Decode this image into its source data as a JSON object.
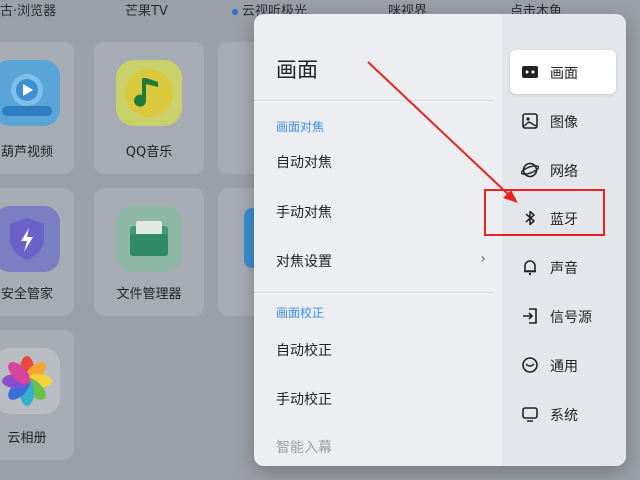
{
  "launcher": {
    "top_labels": [
      "古·浏览器",
      "芒果TV",
      "云视听极光",
      "咪视界",
      "点击木鱼"
    ],
    "tiles": [
      {
        "label": "葫芦视频"
      },
      {
        "label": "QQ音乐"
      },
      {
        "label": "安全管家"
      },
      {
        "label": "文件管理器"
      },
      {
        "label": "云相册"
      }
    ]
  },
  "panel": {
    "title": "画面",
    "sections": [
      {
        "header": "画面对焦",
        "options": [
          "自动对焦",
          "手动对焦",
          "对焦设置"
        ]
      },
      {
        "header": "画面校正",
        "options": [
          "自动校正",
          "手动校正",
          "智能入幕"
        ]
      }
    ],
    "nav": [
      {
        "label": "画面",
        "icon": "display-icon",
        "active": true
      },
      {
        "label": "图像",
        "icon": "image-icon"
      },
      {
        "label": "网络",
        "icon": "globe-icon"
      },
      {
        "label": "蓝牙",
        "icon": "bluetooth-icon"
      },
      {
        "label": "声音",
        "icon": "bell-icon"
      },
      {
        "label": "信号源",
        "icon": "input-source-icon"
      },
      {
        "label": "通用",
        "icon": "general-icon"
      },
      {
        "label": "系统",
        "icon": "system-icon"
      }
    ]
  },
  "annotation": {
    "highlight_color": "#e8231f"
  }
}
